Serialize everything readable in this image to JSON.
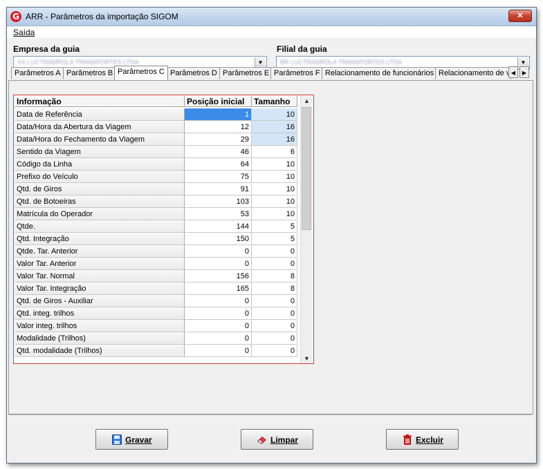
{
  "window": {
    "title": "ARR - Parâmetros da importação  SIGOM",
    "app_icon": "G",
    "close_label": "✕"
  },
  "menu": {
    "items": [
      {
        "label": "Saída"
      }
    ]
  },
  "empresa": {
    "label": "Empresa  da guia",
    "value": "XX LUCTRADROLA TRANSPORTES LTDA"
  },
  "filial": {
    "label": "Filial  da guia",
    "value": "BR LUCTRADROLA TRANSPORTES LTDA"
  },
  "tabs": [
    {
      "label": "Parâmetros A"
    },
    {
      "label": "Parâmetros B"
    },
    {
      "label": "Parâmetros C"
    },
    {
      "label": "Parâmetros D"
    },
    {
      "label": "Parâmetros E"
    },
    {
      "label": "Parâmetros F"
    },
    {
      "label": "Relacionamento de funcionários"
    },
    {
      "label": "Relacionamento de v"
    }
  ],
  "active_tab": "Parâmetros C",
  "table": {
    "headers": {
      "info": "Informação",
      "pos": "Posição inicial",
      "tam": "Tamanho"
    },
    "rows": [
      {
        "info": "Data de Referência",
        "pos": "1",
        "tam": "10"
      },
      {
        "info": "Data/Hora da Abertura da Viagem",
        "pos": "12",
        "tam": "16"
      },
      {
        "info": "Data/Hora do Fechamento da Viagem",
        "pos": "29",
        "tam": "16"
      },
      {
        "info": "Sentido da Viagem",
        "pos": "46",
        "tam": "6"
      },
      {
        "info": "Código da Linha",
        "pos": "64",
        "tam": "10"
      },
      {
        "info": "Prefixo do Veículo",
        "pos": "75",
        "tam": "10"
      },
      {
        "info": "Qtd. de Giros",
        "pos": "91",
        "tam": "10"
      },
      {
        "info": "Qtd. de Botoeiras",
        "pos": "103",
        "tam": "10"
      },
      {
        "info": "Matrícula do Operador",
        "pos": "53",
        "tam": "10"
      },
      {
        "info": "Qtde.",
        "pos": "144",
        "tam": "5"
      },
      {
        "info": "Qtd. Integração",
        "pos": "150",
        "tam": "5"
      },
      {
        "info": "Qtde. Tar. Anterior",
        "pos": "0",
        "tam": "0"
      },
      {
        "info": "Valor Tar. Anterior",
        "pos": "0",
        "tam": "0"
      },
      {
        "info": "Valor Tar. Normal",
        "pos": "156",
        "tam": "8"
      },
      {
        "info": "Valor Tar. Integração",
        "pos": "165",
        "tam": "8"
      },
      {
        "info": "Qtd. de Giros - Auxiliar",
        "pos": "0",
        "tam": "0"
      },
      {
        "info": "Qtd. integ. trilhos",
        "pos": "0",
        "tam": "0"
      },
      {
        "info": "Valor integ. trilhos",
        "pos": "0",
        "tam": "0"
      },
      {
        "info": "Modalidade (Trilhos)",
        "pos": "0",
        "tam": "0"
      },
      {
        "info": "Qtd. modalidade (Trilhos)",
        "pos": "0",
        "tam": "0"
      }
    ]
  },
  "buttons": {
    "gravar": "Gravar",
    "limpar": "Limpar",
    "excluir": "Excluir"
  },
  "colors": {
    "selection": "#3b8ce6",
    "grid_border": "#d63b3b",
    "accent": "#d4202a"
  }
}
